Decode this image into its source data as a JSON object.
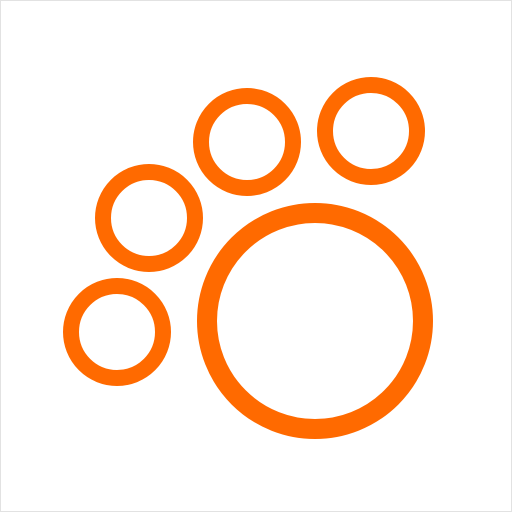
{
  "icon": {
    "name": "paw-print-icon",
    "accent_color": "#ff6a00",
    "background_color": "#ffffff",
    "border_color": "#e2e2e2"
  }
}
